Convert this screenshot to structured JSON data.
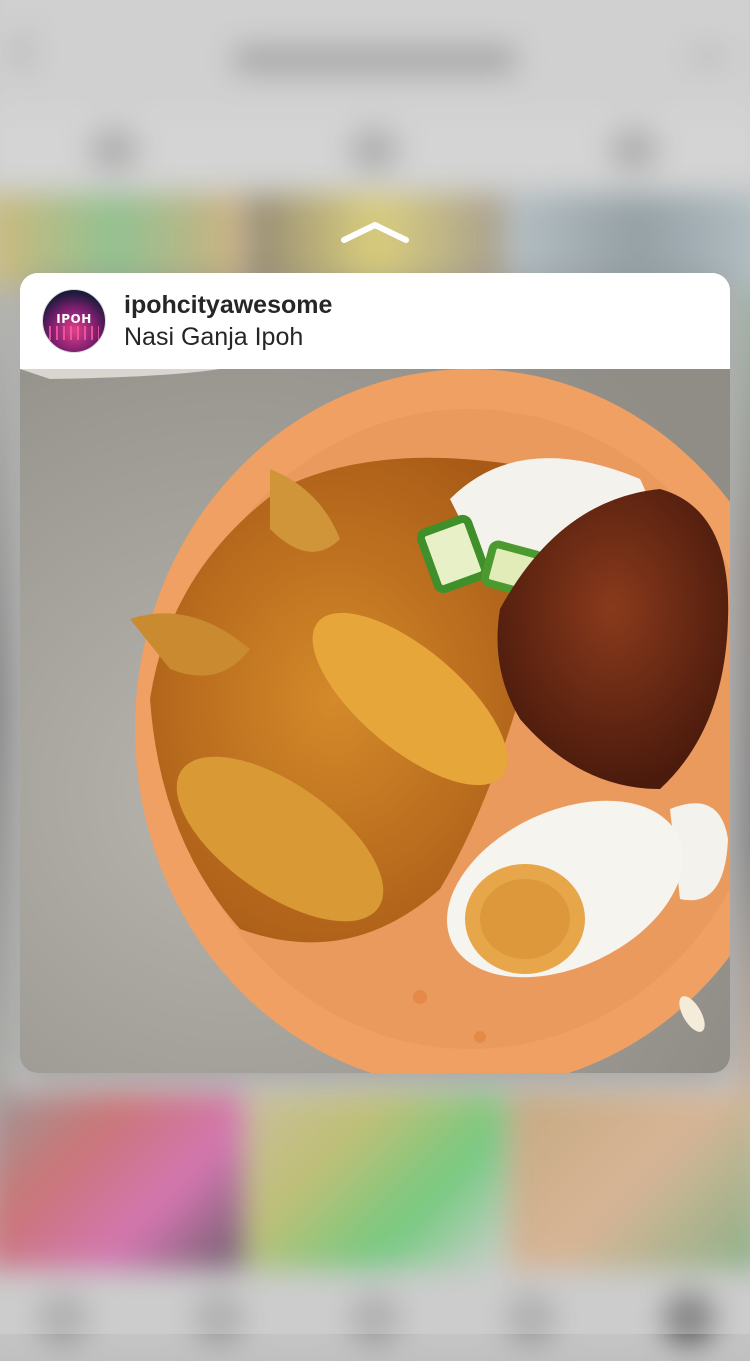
{
  "post": {
    "username": "ipohcityawesome",
    "location": "Nasi Ganja Ipoh",
    "avatar_text": "IPOH"
  },
  "icons": {
    "chevron": "chevron-up-icon",
    "avatar": "profile-avatar"
  },
  "colors": {
    "plate": "#f0a063",
    "card_bg": "#ffffff",
    "text": "#262626"
  }
}
